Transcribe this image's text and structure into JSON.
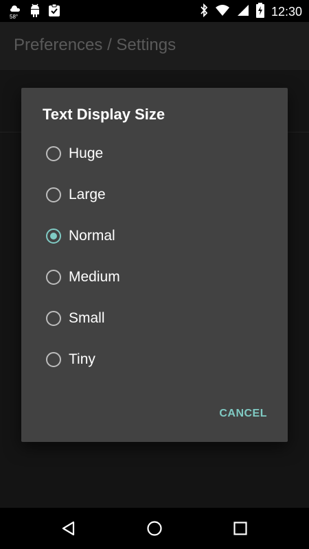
{
  "status_bar": {
    "weather_temp": "58°",
    "time": "12:30",
    "icons": [
      "weather-icon",
      "android-icon",
      "clipboard-check-icon",
      "bluetooth-icon",
      "wifi-icon",
      "signal-icon",
      "battery-charging-icon"
    ]
  },
  "app_bar": {
    "title": "Preferences / Settings"
  },
  "dialog": {
    "title": "Text Display Size",
    "options": [
      {
        "label": "Huge",
        "selected": false
      },
      {
        "label": "Large",
        "selected": false
      },
      {
        "label": "Normal",
        "selected": true
      },
      {
        "label": "Medium",
        "selected": false
      },
      {
        "label": "Small",
        "selected": false
      },
      {
        "label": "Tiny",
        "selected": false
      }
    ],
    "cancel_label": "CANCEL"
  },
  "navigation_bar": {
    "buttons": [
      "back-icon",
      "home-icon",
      "recents-icon"
    ]
  },
  "colors": {
    "accent": "#80cbc4",
    "dialog_bg": "#424242",
    "background": "#141414"
  }
}
